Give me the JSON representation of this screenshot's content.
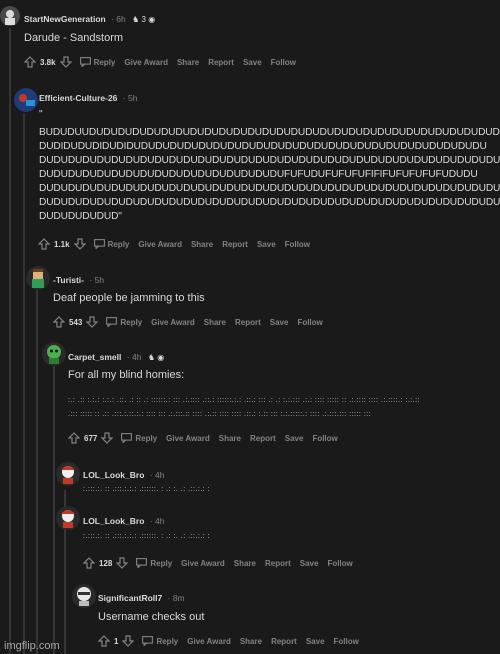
{
  "colors": {
    "background": "#1a1a1b",
    "text": "#d7dadc",
    "muted": "#818384",
    "thread": "#343536"
  },
  "comments": [
    {
      "author": "StartNewGeneration",
      "time": "6h",
      "badge": "3",
      "body": "Darude - Sandstorm",
      "votes": "3.8k",
      "actions": [
        "Reply",
        "Give Award",
        "Share",
        "Report",
        "Save",
        "Follow"
      ]
    },
    {
      "author": "Efficient-Culture-26",
      "time": "5h",
      "body_lines": [
        "\"",
        "BUDUDUUDUDUDUDUDUDUDUDUDUDUDUDUDUDUDUDUDUDUDUDUDUDUDUDUDUDUDUDUDUDI",
        "DUDIDUDUDIDUDIDUDUDUDUDUDUDUDUDUDUDUDUDUDUDUDUDUDUDUDUDUDUDUDUDU",
        "DUDUDUDUDUDUDUDUDUDUDUDUDUDUDUDUDUDUDUDUDUDUDUDUDUDUDUDUDUDUDUDU",
        "DUDUDUDUDUDUDUDUDUDUDUDUDUDUDUDUDUFUFUDUFUFUFUFIFIFUFUFUFUFUDUDU",
        "DUDUDUDUDUDUDUDUDUDUDUDUDUDUDUDUDUDUDUDUDUDUDUDUDUDUDUDUDUDUDUDU",
        "DUDUDUDUDUDUDUDUDUDUDUDUDUDUDUDUDUDUDUDUDUDUDUDUDUDUDUDUDUDUDUDU",
        "DUDUDUDUDUD\""
      ],
      "votes": "1.1k",
      "actions": [
        "Reply",
        "Give Award",
        "Share",
        "Report",
        "Save",
        "Follow"
      ]
    },
    {
      "author": "-Turisti-",
      "time": "5h",
      "body": "Deaf people be jamming to this",
      "votes": "543",
      "actions": [
        "Reply",
        "Give Award",
        "Share",
        "Report",
        "Save",
        "Follow"
      ]
    },
    {
      "author": "Carpet_smell",
      "time": "4h",
      "body": "For all my blind homies:",
      "braille_lines": [
        ":.: .:: :.:.: :.:.: .::. .: :: .: ::::::.: ::: .:.::::  .::.: ::::::.:.:  .::.: ::: .: .: :.:.:::  .:.: ::::  ::::: :: .:.::::  :::: .:.::::.: :.:.::",
        ".::: ::::: :: .::  .:::.:.::.:.: ::::  :::  .:.:::.:: :::: .:.:: ::::  :::: .::.: :.:: ::: :.:.:::::.: ::::  .:.:::.:::  ::::: :::"
      ],
      "votes": "677",
      "actions": [
        "Reply",
        "Give Award",
        "Share",
        "Report",
        "Save",
        "Follow"
      ]
    },
    {
      "author": "LOL_Look_Bro",
      "time": "4h",
      "braille": ":.:::.:. :: .:::.:.:.:  .::::::. :  .: :. .:  .::.:.: :"
    },
    {
      "author": "LOL_Look_Bro",
      "time": "4h",
      "braille": ":.:::.:. :: .:::.:.:.:  .::::::. :  .: :. .:  .::.:.: :",
      "votes": "128",
      "actions": [
        "Reply",
        "Give Award",
        "Share",
        "Report",
        "Save",
        "Follow"
      ]
    },
    {
      "author": "SignificantRoll7",
      "time": "8m",
      "body": "Username checks out",
      "votes": "1",
      "actions": [
        "Reply",
        "Give Award",
        "Share",
        "Report",
        "Save",
        "Follow"
      ]
    }
  ],
  "watermark": "imgflip.com"
}
